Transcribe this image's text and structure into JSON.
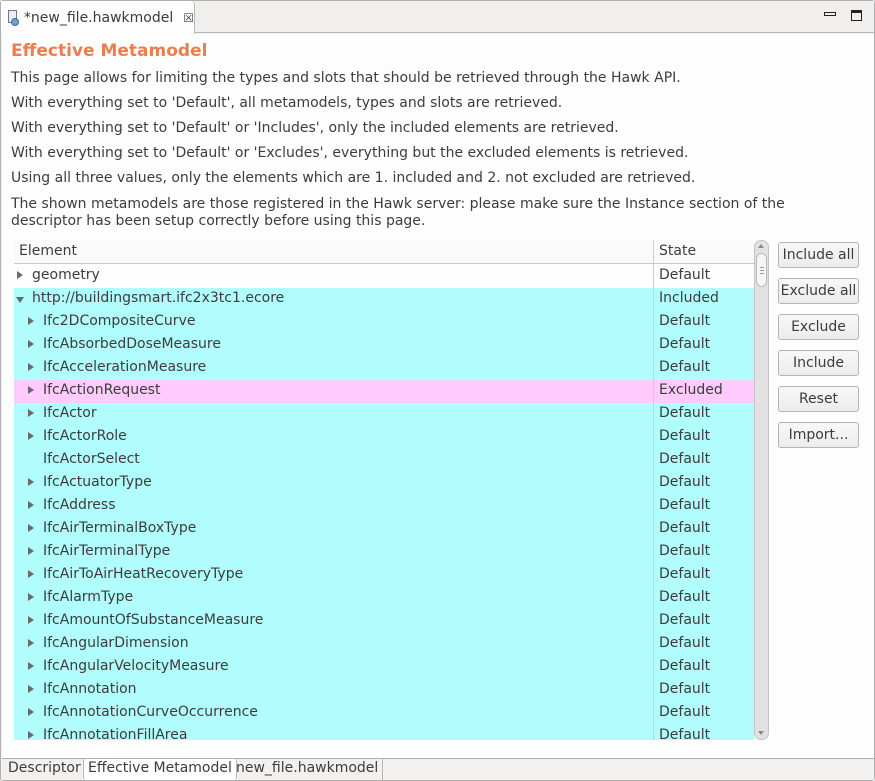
{
  "editor": {
    "tab_title": "*new_file.hawkmodel",
    "tab_icon": "hawkmodel-file-icon",
    "close_icon": "close-icon",
    "minimize_icon": "minimize-icon",
    "maximize_icon": "maximize-icon"
  },
  "page": {
    "title": "Effective Metamodel",
    "title_color": "#ea7f4e",
    "descriptions": [
      "This page allows for limiting the types and slots that should be retrieved through the Hawk API.",
      "With everything set to 'Default', all metamodels, types and slots are retrieved.",
      "With everything set to 'Default' or 'Includes', only the included elements are retrieved.",
      "With everything set to 'Default' or 'Excludes', everything but the excluded elements is retrieved.",
      "Using all three values, only the elements which are 1. included and 2. not excluded are retrieved.",
      "The shown metamodels are those registered in the Hawk server: please make sure the Instance section of the descriptor has been setup correctly before using this page."
    ]
  },
  "tree": {
    "columns": [
      "Element",
      "State"
    ],
    "state_colors": {
      "Included": "#b1fcfc",
      "Excluded": "#fecbfc",
      "Default": "#fdfdfd"
    },
    "rows": [
      {
        "label": "geometry",
        "state": "Default",
        "level": 0,
        "expander": "collapsed",
        "bg": "default-top"
      },
      {
        "label": "http://buildingsmart.ifc2x3tc1.ecore",
        "state": "Included",
        "level": 0,
        "expander": "expanded",
        "bg": "included"
      },
      {
        "label": "Ifc2DCompositeCurve",
        "state": "Default",
        "level": 1,
        "expander": "collapsed",
        "bg": "included"
      },
      {
        "label": "IfcAbsorbedDoseMeasure",
        "state": "Default",
        "level": 1,
        "expander": "collapsed",
        "bg": "included"
      },
      {
        "label": "IfcAccelerationMeasure",
        "state": "Default",
        "level": 1,
        "expander": "collapsed",
        "bg": "included"
      },
      {
        "label": "IfcActionRequest",
        "state": "Excluded",
        "level": 1,
        "expander": "collapsed",
        "bg": "excluded"
      },
      {
        "label": "IfcActor",
        "state": "Default",
        "level": 1,
        "expander": "collapsed",
        "bg": "included"
      },
      {
        "label": "IfcActorRole",
        "state": "Default",
        "level": 1,
        "expander": "collapsed",
        "bg": "included"
      },
      {
        "label": "IfcActorSelect",
        "state": "Default",
        "level": 1,
        "expander": "none",
        "bg": "included"
      },
      {
        "label": "IfcActuatorType",
        "state": "Default",
        "level": 1,
        "expander": "collapsed",
        "bg": "included"
      },
      {
        "label": "IfcAddress",
        "state": "Default",
        "level": 1,
        "expander": "collapsed",
        "bg": "included"
      },
      {
        "label": "IfcAirTerminalBoxType",
        "state": "Default",
        "level": 1,
        "expander": "collapsed",
        "bg": "included"
      },
      {
        "label": "IfcAirTerminalType",
        "state": "Default",
        "level": 1,
        "expander": "collapsed",
        "bg": "included"
      },
      {
        "label": "IfcAirToAirHeatRecoveryType",
        "state": "Default",
        "level": 1,
        "expander": "collapsed",
        "bg": "included"
      },
      {
        "label": "IfcAlarmType",
        "state": "Default",
        "level": 1,
        "expander": "collapsed",
        "bg": "included"
      },
      {
        "label": "IfcAmountOfSubstanceMeasure",
        "state": "Default",
        "level": 1,
        "expander": "collapsed",
        "bg": "included"
      },
      {
        "label": "IfcAngularDimension",
        "state": "Default",
        "level": 1,
        "expander": "collapsed",
        "bg": "included"
      },
      {
        "label": "IfcAngularVelocityMeasure",
        "state": "Default",
        "level": 1,
        "expander": "collapsed",
        "bg": "included"
      },
      {
        "label": "IfcAnnotation",
        "state": "Default",
        "level": 1,
        "expander": "collapsed",
        "bg": "included"
      },
      {
        "label": "IfcAnnotationCurveOccurrence",
        "state": "Default",
        "level": 1,
        "expander": "collapsed",
        "bg": "included"
      },
      {
        "label": "IfcAnnotationFillArea",
        "state": "Default",
        "level": 1,
        "expander": "collapsed",
        "bg": "included"
      }
    ]
  },
  "buttons": {
    "include_all": "Include all",
    "exclude_all": "Exclude all",
    "exclude": "Exclude",
    "include": "Include",
    "reset": "Reset",
    "import": "Import..."
  },
  "bottom_tabs": [
    {
      "label": "Descriptor",
      "active": false
    },
    {
      "label": "Effective Metamodel",
      "active": true
    },
    {
      "label": "new_file.hawkmodel",
      "active": false
    }
  ]
}
